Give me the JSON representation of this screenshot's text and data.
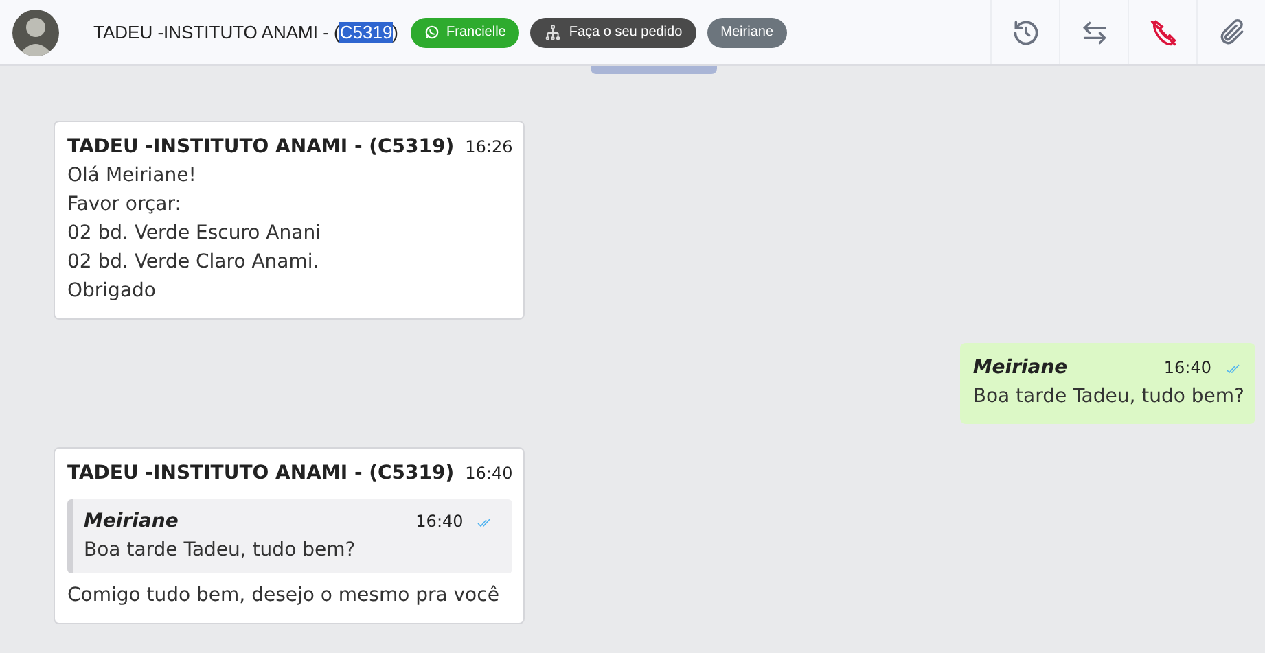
{
  "header": {
    "title": [
      {
        "text": "TADEU -INSTITUTO ANAMI - (",
        "selected": false
      },
      {
        "text": "C5319",
        "selected": true
      },
      {
        "text": ")",
        "selected": false
      }
    ],
    "tags": [
      {
        "label": "Francielle",
        "kind": "whatsapp",
        "color": "#2eab2e"
      },
      {
        "label": "Faça o seu pedido",
        "kind": "flow",
        "color": "#4a4a4a"
      },
      {
        "label": "Meiriane",
        "kind": "plain",
        "color": "#6c757d"
      }
    ],
    "actions": [
      {
        "kind": "history"
      },
      {
        "kind": "transfer"
      },
      {
        "kind": "hangup"
      },
      {
        "kind": "attach"
      }
    ]
  },
  "messages": [
    {
      "kind": "incoming",
      "sender": "TADEU -INSTITUTO ANAMI - (C5319)",
      "time": "16:26",
      "lines": [
        "Olá Meiriane!",
        "Favor orçar:",
        "02 bd. Verde Escuro Anani",
        "02 bd. Verde Claro Anami.",
        "Obrigado"
      ]
    },
    {
      "kind": "outgoing",
      "sender": "Meiriane",
      "time": "16:40",
      "read": true,
      "lines": [
        "Boa tarde Tadeu, tudo bem?"
      ]
    },
    {
      "kind": "incoming",
      "sender": "TADEU -INSTITUTO ANAMI - (C5319)",
      "time": "16:40",
      "quote": {
        "sender": "Meiriane",
        "time": "16:40",
        "read": true,
        "text": "Boa tarde Tadeu, tudo bem?"
      },
      "lines": [
        "Comigo tudo bem, desejo o mesmo pra você"
      ]
    }
  ]
}
